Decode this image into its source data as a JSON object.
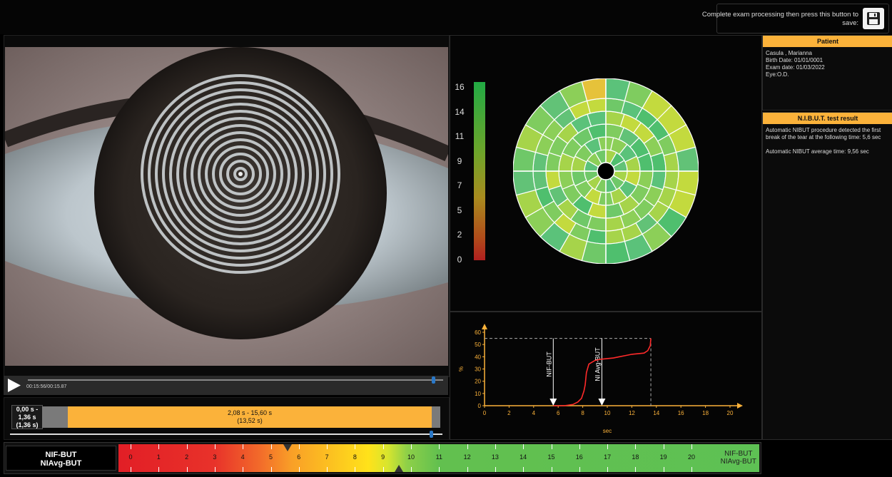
{
  "save": {
    "text": "Complete exam processing then press this button to save:"
  },
  "player": {
    "time": "00:15:56/00:15.87",
    "progress": 0.97
  },
  "range": {
    "start_line1": "0,00 s -",
    "start_line2": "1,36 s",
    "start_line3": "(1,36 s)",
    "sel_line1": "2,08 s - 15,60 s",
    "sel_line2": "(13,52 s)"
  },
  "scale": {
    "labels": [
      "16",
      "14",
      "11",
      "9",
      "7",
      "5",
      "2",
      "0"
    ]
  },
  "patient": {
    "title": "Patient",
    "name": "Casula , Marianna",
    "birth": "Birth Date: 01/01/0001",
    "exam": "Exam date: 01/03/2022",
    "eye": "Eye:O.D."
  },
  "nibut": {
    "title": "N.I.B.U.T. test result",
    "text1": "Automatic NIBUT procedure detected the first break of the tear at the following time: 5,6 sec",
    "text2": "Automatic NIBUT average  time: 9,56 sec"
  },
  "bottom": {
    "label1": "NIF-BUT",
    "label2": "NIAvg-BUT",
    "right1": "NIF-BUT",
    "right2": "NIAvg-BUT",
    "ticks": [
      "0",
      "1",
      "2",
      "3",
      "4",
      "5",
      "6",
      "7",
      "8",
      "9",
      "10",
      "11",
      "12",
      "13",
      "14",
      "15",
      "16",
      "17",
      "18",
      "19",
      "20"
    ],
    "nif_marker": 5.6,
    "niavg_marker": 9.56
  },
  "colors": {
    "accent": "#fbb23a",
    "blue": "#2a78c8"
  },
  "chart_data": {
    "type": "line",
    "xlabel": "sec",
    "ylabel": "%",
    "xlim": [
      0,
      20
    ],
    "ylim": [
      0,
      60
    ],
    "xticks": [
      0,
      2,
      4,
      6,
      8,
      10,
      12,
      14,
      16,
      18,
      20
    ],
    "yticks": [
      0,
      10,
      20,
      30,
      40,
      50,
      60
    ],
    "series": [
      {
        "x": [
          5.6,
          6.5,
          7.2,
          7.6,
          7.9,
          8.1,
          8.2,
          8.3,
          8.5,
          9.0,
          9.5,
          10.0,
          10.5,
          11.0,
          11.5,
          12.0,
          12.5,
          13.0,
          13.3,
          13.5,
          13.55
        ],
        "y": [
          0,
          0,
          1,
          3,
          6,
          12,
          17,
          27,
          34,
          37,
          38,
          38.5,
          39,
          40,
          41,
          42,
          42.5,
          43,
          45,
          49,
          55
        ]
      }
    ],
    "annotations": [
      {
        "label": "NIF-BUT",
        "x": 5.6
      },
      {
        "label": "NI Avg-BUT",
        "x": 9.56
      }
    ],
    "max_point": {
      "x": 13.55,
      "y": 55
    }
  }
}
